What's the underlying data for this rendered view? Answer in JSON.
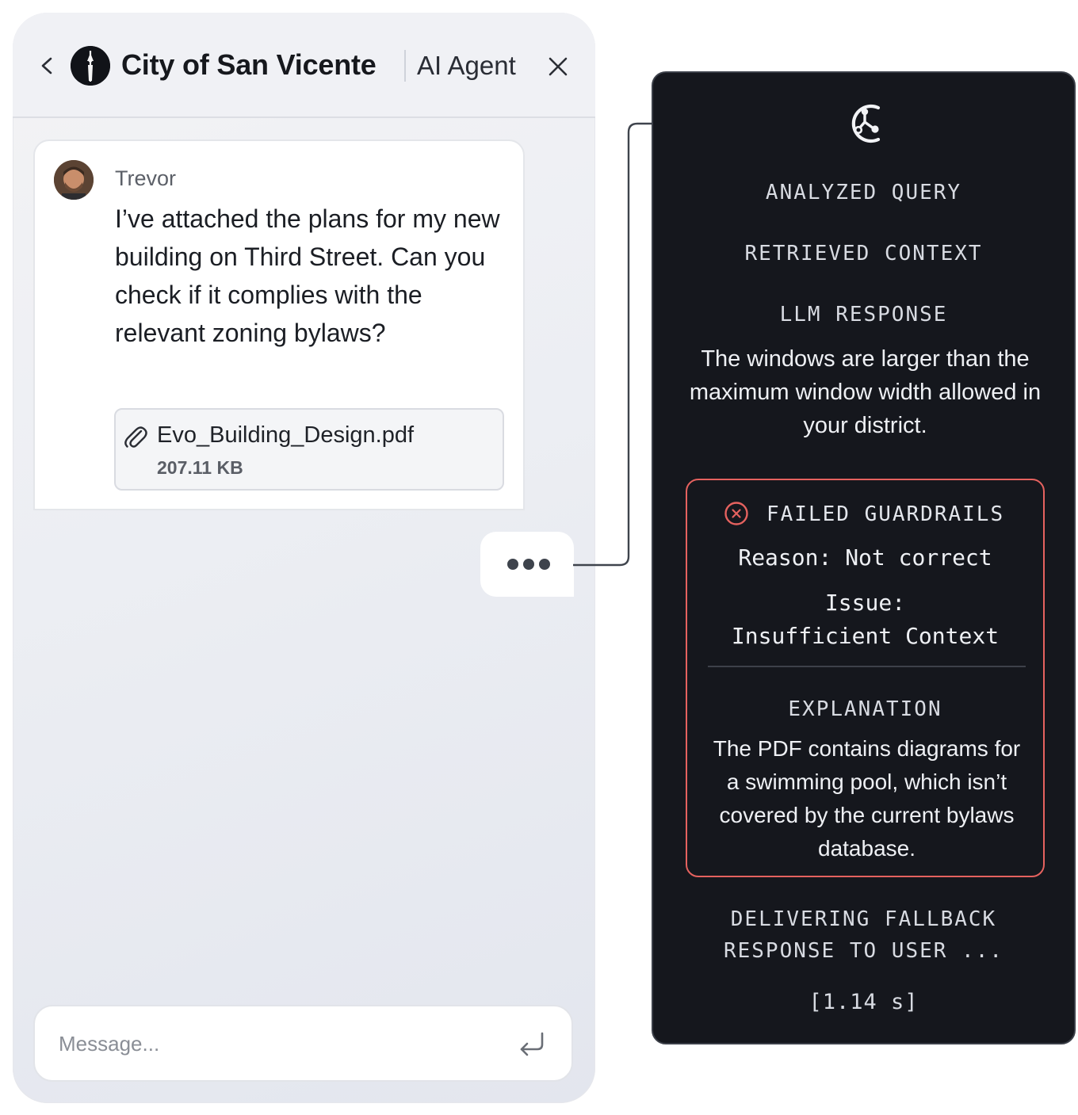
{
  "header": {
    "org_name": "City of San Vicente",
    "agent_label": "AI Agent"
  },
  "message": {
    "sender": "Trevor",
    "text": "I’ve attached the plans for my new building on Third Street. Can you check if it complies with the relevant zoning bylaws?",
    "attachment": {
      "file_name": "Evo_Building_Design.pdf",
      "file_size": "207.11 KB"
    }
  },
  "input": {
    "placeholder": "Message..."
  },
  "trace": {
    "steps": {
      "analyzed": "ANALYZED QUERY",
      "retrieved": "RETRIEVED CONTEXT",
      "llm": "LLM RESPONSE"
    },
    "llm_response": "The windows are larger than the maximum window width allowed in your district.",
    "guardrails": {
      "title": "FAILED GUARDRAILS",
      "reason": "Reason: Not correct",
      "issue_label": "Issue:",
      "issue_value": "Insufficient Context",
      "explanation_title": "EXPLANATION",
      "explanation": "The PDF contains diagrams for a swimming pool, which isn’t covered by the current bylaws database."
    },
    "fallback_line1": "DELIVERING FALLBACK",
    "fallback_line2": "RESPONSE TO USER ...",
    "timing": "[1.14 s]"
  },
  "colors": {
    "panel_bg": "#15171d",
    "guardrail_red": "#e5625f",
    "chat_bg": "#eceef3"
  },
  "icons": [
    "chevron-left-icon",
    "city-logo-icon",
    "close-icon",
    "avatar",
    "paperclip-icon",
    "typing-dots-icon",
    "enter-icon",
    "trace-logo-icon",
    "error-x-icon"
  ]
}
